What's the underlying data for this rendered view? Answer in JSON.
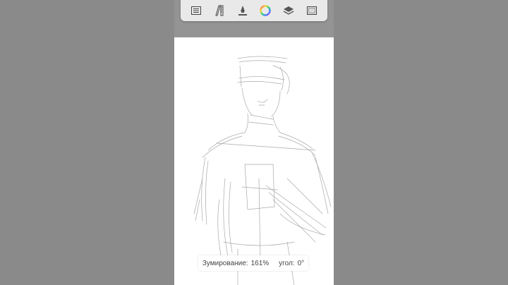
{
  "app": {
    "accent": "#e9e9e9",
    "background": "#8a8a8a"
  },
  "toolbar": {
    "items": [
      {
        "icon": "list-icon"
      },
      {
        "icon": "ruler-pencil-icon"
      },
      {
        "icon": "brush-icon"
      },
      {
        "icon": "color-wheel-icon"
      },
      {
        "icon": "layers-icon"
      },
      {
        "icon": "canvas-frame-icon"
      }
    ]
  },
  "status": {
    "zoom_label": "Зумирование:",
    "zoom_value": "161%",
    "angle_label": "угол:",
    "angle_value": "0°"
  }
}
